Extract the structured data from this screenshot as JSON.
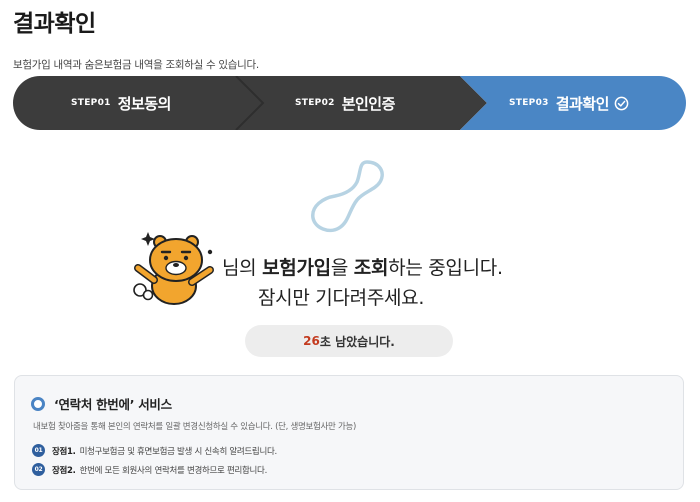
{
  "page": {
    "title": "결과확인",
    "subtitle": "보험가입 내역과 숨은보험금 내역을 조회하실 수 있습니다."
  },
  "steps": [
    {
      "num": "STEP01",
      "label": "정보동의",
      "state": "done"
    },
    {
      "num": "STEP02",
      "label": "본인인증",
      "state": "done"
    },
    {
      "num": "STEP03",
      "label": "결과확인",
      "state": "active",
      "icon": "check-circle-icon"
    }
  ],
  "colors": {
    "step_dark": "#3c3c3c",
    "step_active": "#4a86c5",
    "accent_count": "#c33a1e",
    "badge": "#2f5f9e"
  },
  "status": {
    "name_suffix": "님의 ",
    "part1": "보험가입",
    "part2": "을 ",
    "part3": "조회",
    "part4": "하는 중입니다.",
    "line2": "잠시만 기다려주세요."
  },
  "timer": {
    "seconds": "26",
    "suffix": "초 남았습니다."
  },
  "service": {
    "title": "‘연락처 한번에’ 서비스",
    "description": "내보험 찾아줌을 통해 본인의 연락처를 일괄 변경신청하실 수 있습니다. (단, 생명보험사만 가능)",
    "benefits": [
      {
        "badge": "01",
        "name": "장점1.",
        "text": "미청구보험금 및 휴면보험금 발생 시 신속히 알려드립니다."
      },
      {
        "badge": "02",
        "name": "장점2.",
        "text": "한번에 모든 회원사의 연락처를 변경하므로 편리합니다."
      }
    ]
  }
}
